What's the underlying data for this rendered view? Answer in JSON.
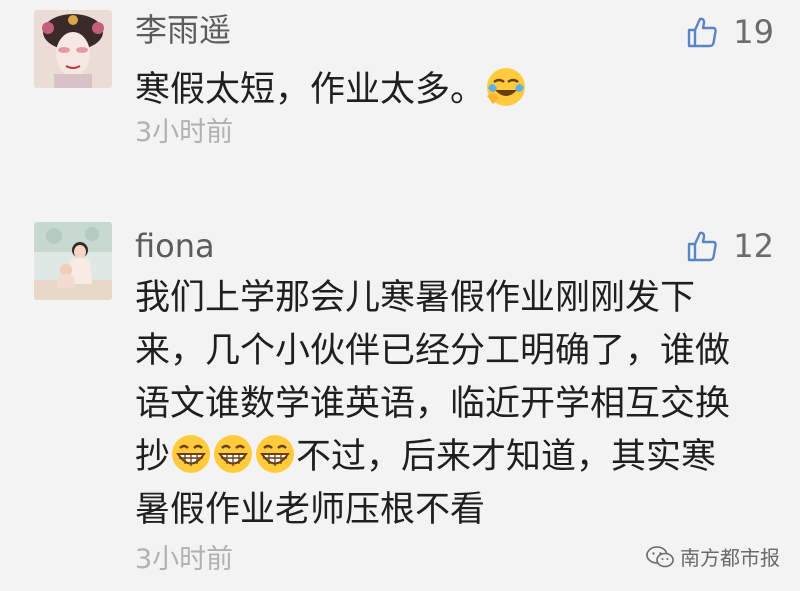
{
  "comments": [
    {
      "username": "李雨遥",
      "likes": "19",
      "avatar_icon": "opera-makeup-avatar",
      "text_lines": [
        "寒假太短，作业太多。"
      ],
      "time": "3小时前"
    },
    {
      "username": "fiona",
      "likes": "12",
      "avatar_icon": "photo-avatar",
      "text_lines": [
        "我们上学那会儿寒暑假作业刚刚发下",
        "来，几个小伙伴已经分工明确了，谁做",
        "语文谁数学谁英语，临近开学相互交换",
        "抄",
        "不过，后来才知道，其实寒",
        "暑假作业老师压根不看"
      ],
      "time": "3小时前"
    }
  ],
  "watermark": {
    "text": "南方都市报",
    "icon": "wechat-icon"
  },
  "colors": {
    "background": "#f3f3f3",
    "username": "#5c5c5c",
    "text": "#1f1f1f",
    "time": "#b1b1b1",
    "like": "#5b84c4"
  }
}
